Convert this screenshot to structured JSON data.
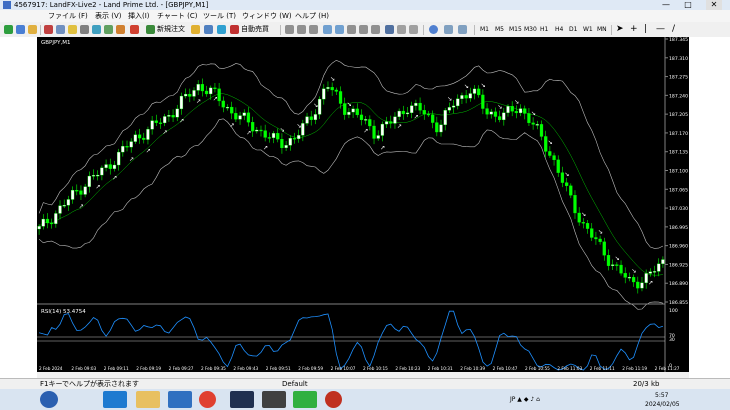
{
  "window": {
    "title": "4567917: LandFX-Live2 - Land Prime Ltd. - [GBPJPY,M1]",
    "minimize": "—",
    "maximize": "□",
    "close": "✕"
  },
  "menu": [
    "ファイル (F)",
    "表示 (V)",
    "挿入(I)",
    "チャート (C)",
    "ツール (T)",
    "ウィンドウ (W)",
    "ヘルプ (H)"
  ],
  "toolbar": {
    "new_order": "新規注文",
    "auto_trade": "自動売買",
    "timeframes": [
      "M1",
      "M5",
      "M15",
      "M30",
      "H1",
      "H4",
      "D1",
      "W1",
      "MN"
    ]
  },
  "chart": {
    "symbol_label": "GBPJPY,M1",
    "rsi_label": "RSI(14) 53.4754",
    "price_ticks": [
      "187.345",
      "187.310",
      "187.275",
      "187.240",
      "187.205",
      "187.170",
      "187.135",
      "187.100",
      "187.065",
      "187.030",
      "186.995",
      "186.960",
      "186.925",
      "186.890",
      "186.855"
    ],
    "rsi_ticks": [
      "100",
      "70",
      "30",
      "0"
    ],
    "time_ticks": [
      "2 Feb 2024",
      "2 Feb 09:03",
      "2 Feb 09:11",
      "2 Feb 09:19",
      "2 Feb 09:27",
      "2 Feb 09:35",
      "2 Feb 09:43",
      "2 Feb 09:51",
      "2 Feb 09:59",
      "2 Feb 10:07",
      "2 Feb 10:15",
      "2 Feb 10:23",
      "2 Feb 10:31",
      "2 Feb 10:39",
      "2 Feb 10:47",
      "2 Feb 10:55",
      "2 Feb 11:03",
      "2 Feb 11:11",
      "2 Feb 11:19",
      "2 Feb 11:27"
    ],
    "colors": {
      "bull": "#ffffff",
      "bear": "#00ff00",
      "wick": "#00ff00",
      "band": "#c0c0c0",
      "rsi": "#1e90ff",
      "bg": "#000000"
    }
  },
  "chart_data": {
    "type": "candlestick",
    "symbol": "GBPJPY",
    "timeframe": "M1",
    "ylim": [
      186.855,
      187.345
    ],
    "xrange": [
      "2 Feb 2024 08:55",
      "2 Feb 11:27"
    ],
    "close_approx": [
      186.99,
      187.02,
      187.05,
      187.08,
      187.1,
      187.13,
      187.16,
      187.18,
      187.2,
      187.23,
      187.26,
      187.24,
      187.21,
      187.19,
      187.17,
      187.15,
      187.16,
      187.2,
      187.26,
      187.22,
      187.2,
      187.17,
      187.19,
      187.22,
      187.21,
      187.18,
      187.23,
      187.25,
      187.21,
      187.2,
      187.22,
      187.18,
      187.13,
      187.06,
      187.0,
      186.96,
      186.92,
      186.89,
      186.9,
      186.93
    ],
    "rsi_last": 53.4754
  },
  "status": {
    "help": "F1キーでヘルプが表示されます",
    "profile": "Default",
    "traffic": "20/3 kb"
  },
  "taskbar": {
    "time": "5:57",
    "date": "2024/02/05"
  }
}
